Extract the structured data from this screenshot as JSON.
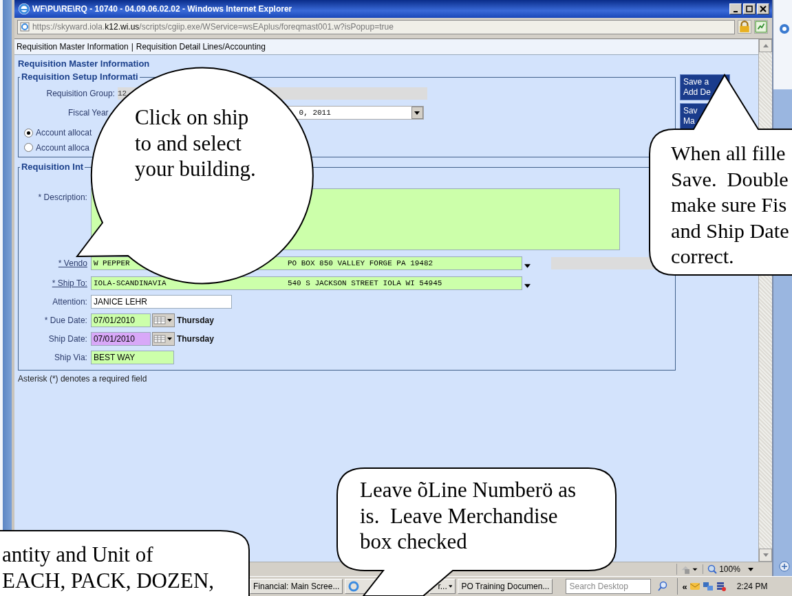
{
  "window": {
    "title": "WF\\PU\\RE\\RQ - 10740 - 04.09.06.02.02 - Windows Internet Explorer",
    "url": "https://skyward.iola.**k12.wi.us**/scripts/cgiip.exe/WService=wsEAplus/foreqmast001.w?isPopup=true"
  },
  "tabs": {
    "items": [
      {
        "label": "Requisition Master Information"
      },
      {
        "label": "Requisition Detail Lines/Accounting"
      }
    ],
    "separator": "|"
  },
  "heading": "Requisition Master Information",
  "setup": {
    "legend": "Requisition Setup Informati",
    "group_label": "Requisition Group:",
    "group_value": "12",
    "fiscal_label": "Fiscal Year",
    "fiscal_value": "0, 2011",
    "options": [
      {
        "label": "Account allocat",
        "selected": true
      },
      {
        "label": "Account alloca",
        "selected": false
      }
    ]
  },
  "buttons": [
    {
      "lines": [
        "Save a",
        "Add De"
      ]
    },
    {
      "lines": [
        "Sav",
        "Ma"
      ]
    }
  ],
  "info": {
    "legend": "Requisition Int",
    "fields": [
      {
        "kind": "textarea",
        "label": "* Description:",
        "color": "#ccffaa"
      },
      {
        "kind": "lookup",
        "label": "* Vendo",
        "value": "W PEPPER",
        "address": "PO BOX 850 VALLEY FORGE PA 19482",
        "color": "#ccffaa"
      },
      {
        "kind": "lookup",
        "label": "* Ship To:",
        "value": "IOLA-SCANDINAVIA",
        "address": "540 S JACKSON STREET IOLA WI 54945",
        "color": "#ccffaa"
      },
      {
        "kind": "text",
        "label": "Attention:",
        "value": "JANICE LEHR",
        "color": "#ffffff"
      },
      {
        "kind": "date",
        "label": "* Due Date:",
        "value": "07/01/2010",
        "day": "Thursday",
        "color": "#ccffaa"
      },
      {
        "kind": "date",
        "label": "Ship Date:",
        "value": "07/01/2010",
        "day": "Thursday",
        "color": "#d8a8f8"
      },
      {
        "kind": "text",
        "label": "Ship Via:",
        "value": "BEST WAY",
        "color": "#ccffaa"
      }
    ]
  },
  "note": "Asterisk (*) denotes a required field",
  "status_bar": {
    "zoom": "100%"
  },
  "taskbar": {
    "items": [
      {
        "kind": "button",
        "label": "Financial: Main Scree..."
      },
      {
        "kind": "icon"
      },
      {
        "kind": "menu",
        "label": "r..."
      },
      {
        "kind": "button",
        "label": "PO Training Documen..."
      }
    ],
    "search": {
      "placeholder": "Search Desktop"
    },
    "tray_expand": "«",
    "clock": "2:24 PM"
  },
  "callouts": [
    {
      "kind": "ellipse",
      "lines": [
        "Click on ship",
        "to and select",
        "your building."
      ]
    },
    {
      "kind": "top-tail",
      "lines": [
        "When all fille",
        "Save.  Double",
        "make sure Fis",
        "and Ship Date",
        "correct."
      ]
    },
    {
      "kind": "bottom-tail",
      "lines": [
        "Leave õLine Numberö as",
        "is.  Leave Merchandise",
        "box checked"
      ]
    },
    {
      "kind": "plain",
      "lines": [
        "antity and Unit of",
        "EACH, PACK, DOZEN,"
      ]
    }
  ]
}
